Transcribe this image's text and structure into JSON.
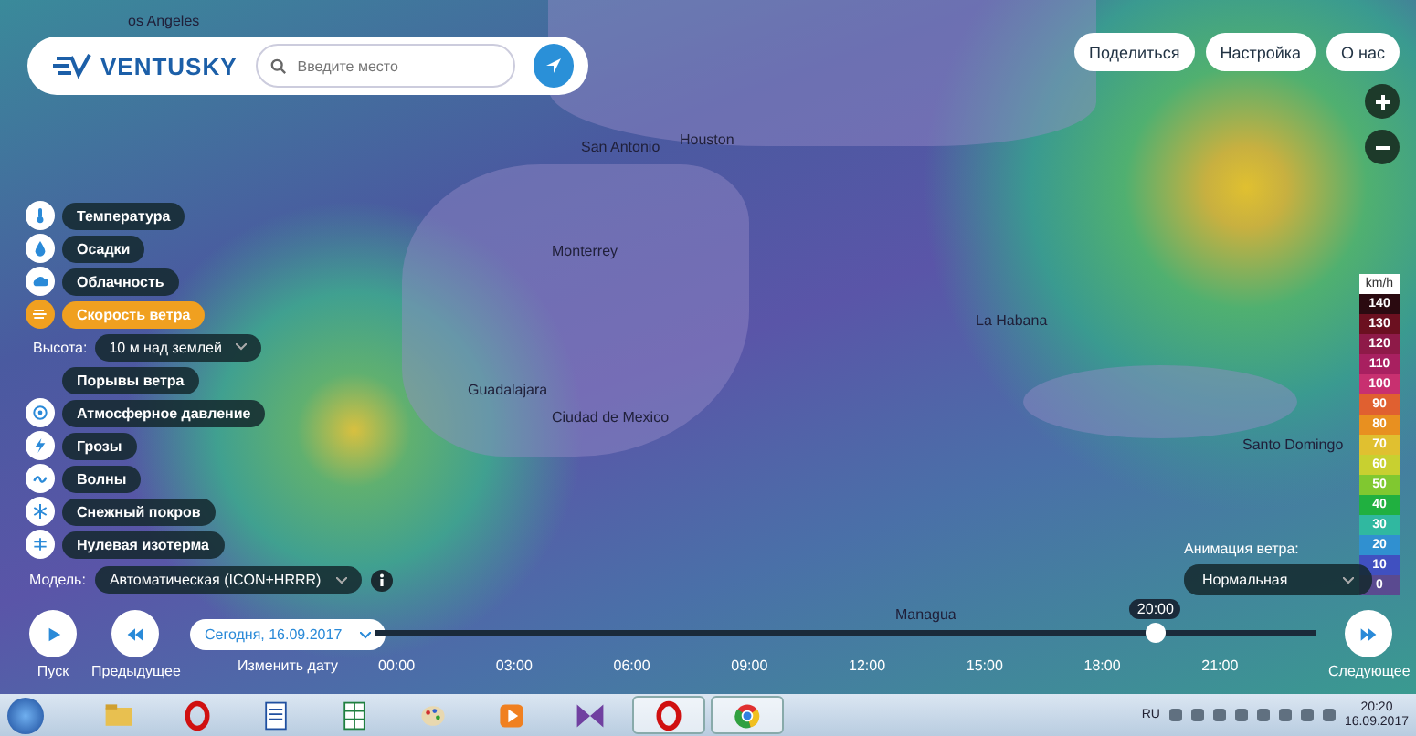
{
  "header": {
    "logo": "VENTUSKY",
    "search": {
      "placeholder": "Введите место"
    },
    "buttons": [
      "Поделиться",
      "Настройка",
      "О нас"
    ]
  },
  "map_labels": [
    "os Angeles",
    "San Antonio",
    "Houston",
    "Monterrey",
    "Guadalajara",
    "Ciudad de Mexico",
    "La Habana",
    "Santo Domingo",
    "Managua"
  ],
  "layers": [
    {
      "kind": "temperature",
      "label": "Температура",
      "selected": false
    },
    {
      "kind": "precipitation",
      "label": "Осадки",
      "selected": false
    },
    {
      "kind": "clouds",
      "label": "Облачность",
      "selected": false
    },
    {
      "kind": "wind",
      "label": "Скорость ветра",
      "selected": true
    },
    {
      "kind": "height",
      "label": "Высота:",
      "value": "10 м над землей"
    },
    {
      "kind": "plain",
      "label": "Порывы ветра",
      "selected": false
    },
    {
      "kind": "pressure",
      "label": "Атмосферное давление",
      "selected": false
    },
    {
      "kind": "storms",
      "label": "Грозы",
      "selected": false
    },
    {
      "kind": "waves",
      "label": "Волны",
      "selected": false
    },
    {
      "kind": "snow",
      "label": "Снежный покров",
      "selected": false
    },
    {
      "kind": "isotherm",
      "label": "Нулевая изотерма",
      "selected": false
    }
  ],
  "model": {
    "label": "Модель:",
    "value": "Автоматическая (ICON+HRRR)"
  },
  "legend": {
    "unit": "km/h",
    "steps": [
      {
        "value": "140",
        "color": "#2a0a10"
      },
      {
        "value": "130",
        "color": "#6b1020"
      },
      {
        "value": "120",
        "color": "#8e1a48"
      },
      {
        "value": "110",
        "color": "#a82060"
      },
      {
        "value": "100",
        "color": "#c83070"
      },
      {
        "value": "90",
        "color": "#e06030"
      },
      {
        "value": "80",
        "color": "#e89020"
      },
      {
        "value": "70",
        "color": "#e0c030"
      },
      {
        "value": "60",
        "color": "#c8d030"
      },
      {
        "value": "50",
        "color": "#80c830"
      },
      {
        "value": "40",
        "color": "#20b040"
      },
      {
        "value": "30",
        "color": "#30b8a0"
      },
      {
        "value": "20",
        "color": "#3090d0"
      },
      {
        "value": "10",
        "color": "#4050c0"
      },
      {
        "value": "0",
        "color": "#5a4a90"
      }
    ]
  },
  "animation": {
    "label": "Анимация ветра:",
    "value": "Нормальная"
  },
  "timeline": {
    "play": "Пуск",
    "previous": "Предыдущее",
    "change_date": "Изменить дату",
    "date": "Сегодня, 16.09.2017",
    "next": "Следующее",
    "current_time": "20:00",
    "level": 0.83,
    "ticks": [
      "00:00",
      "03:00",
      "06:00",
      "09:00",
      "12:00",
      "15:00",
      "18:00",
      "21:00"
    ]
  },
  "taskbar": {
    "apps": [
      {
        "kind": "folder",
        "selected": false
      },
      {
        "kind": "ring",
        "selected": false
      },
      {
        "kind": "document",
        "selected": false
      },
      {
        "kind": "spreadsheet",
        "selected": false
      },
      {
        "kind": "palette",
        "selected": false
      },
      {
        "kind": "media",
        "selected": false
      },
      {
        "kind": "bowtie",
        "selected": false
      },
      {
        "kind": "ring",
        "selected": true
      },
      {
        "kind": "globe",
        "selected": true
      }
    ],
    "language": "RU",
    "time": "20:20",
    "date": "16.09.2017"
  }
}
